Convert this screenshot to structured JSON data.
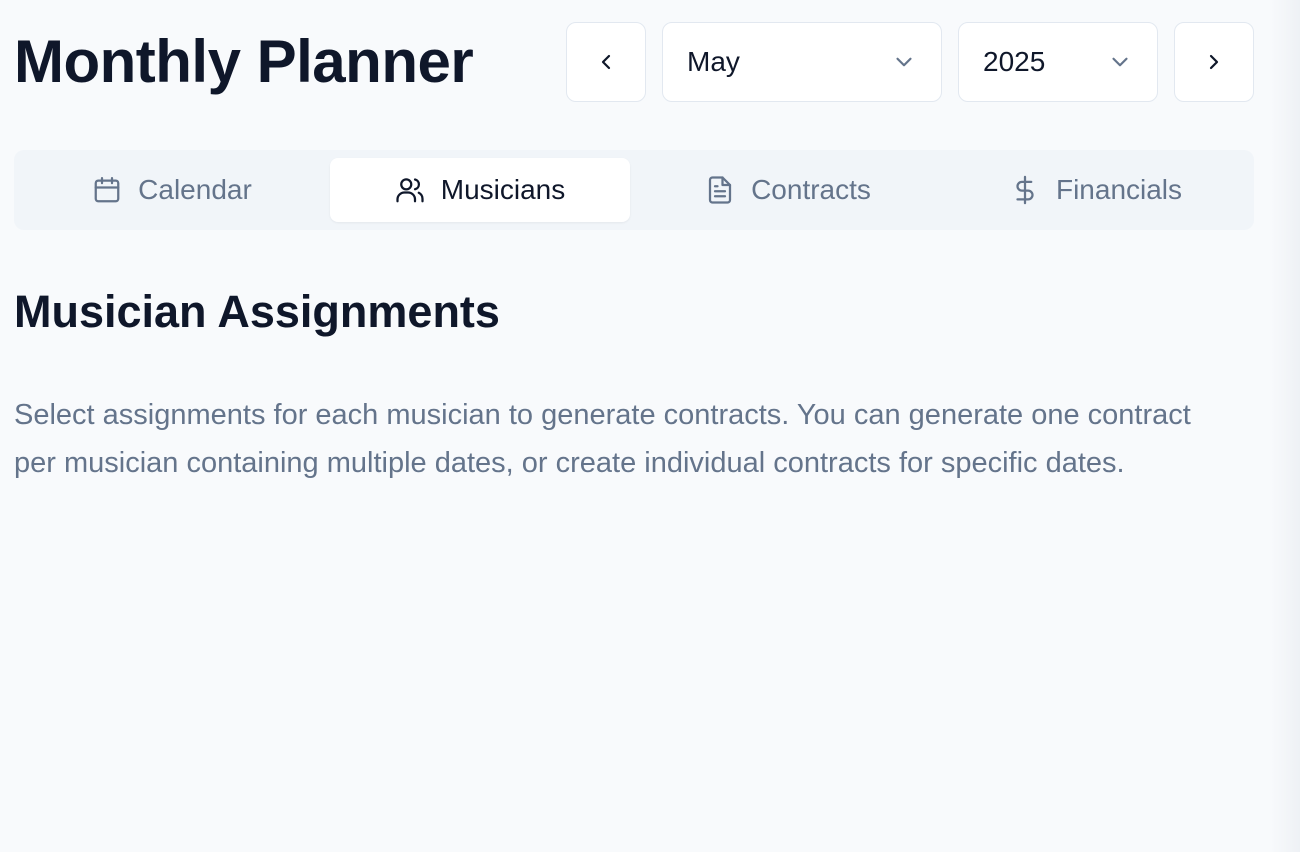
{
  "header": {
    "title": "Monthly Planner",
    "month_selected": "May",
    "year_selected": "2025"
  },
  "tabs": [
    {
      "label": "Calendar",
      "icon": "calendar-icon",
      "active": false
    },
    {
      "label": "Musicians",
      "icon": "users-icon",
      "active": true
    },
    {
      "label": "Contracts",
      "icon": "document-icon",
      "active": false
    },
    {
      "label": "Financials",
      "icon": "dollar-icon",
      "active": false
    }
  ],
  "main": {
    "section_title": "Musician Assignments",
    "description": "Select assignments for each musician to generate contracts. You can generate one contract per musician containing multiple dates, or create individual contracts for specific dates."
  },
  "colors": {
    "background": "#f8fafc",
    "text_primary": "#0f172a",
    "text_muted": "#64748b",
    "border": "#e2e8f0",
    "tab_track": "#f1f5f9"
  }
}
